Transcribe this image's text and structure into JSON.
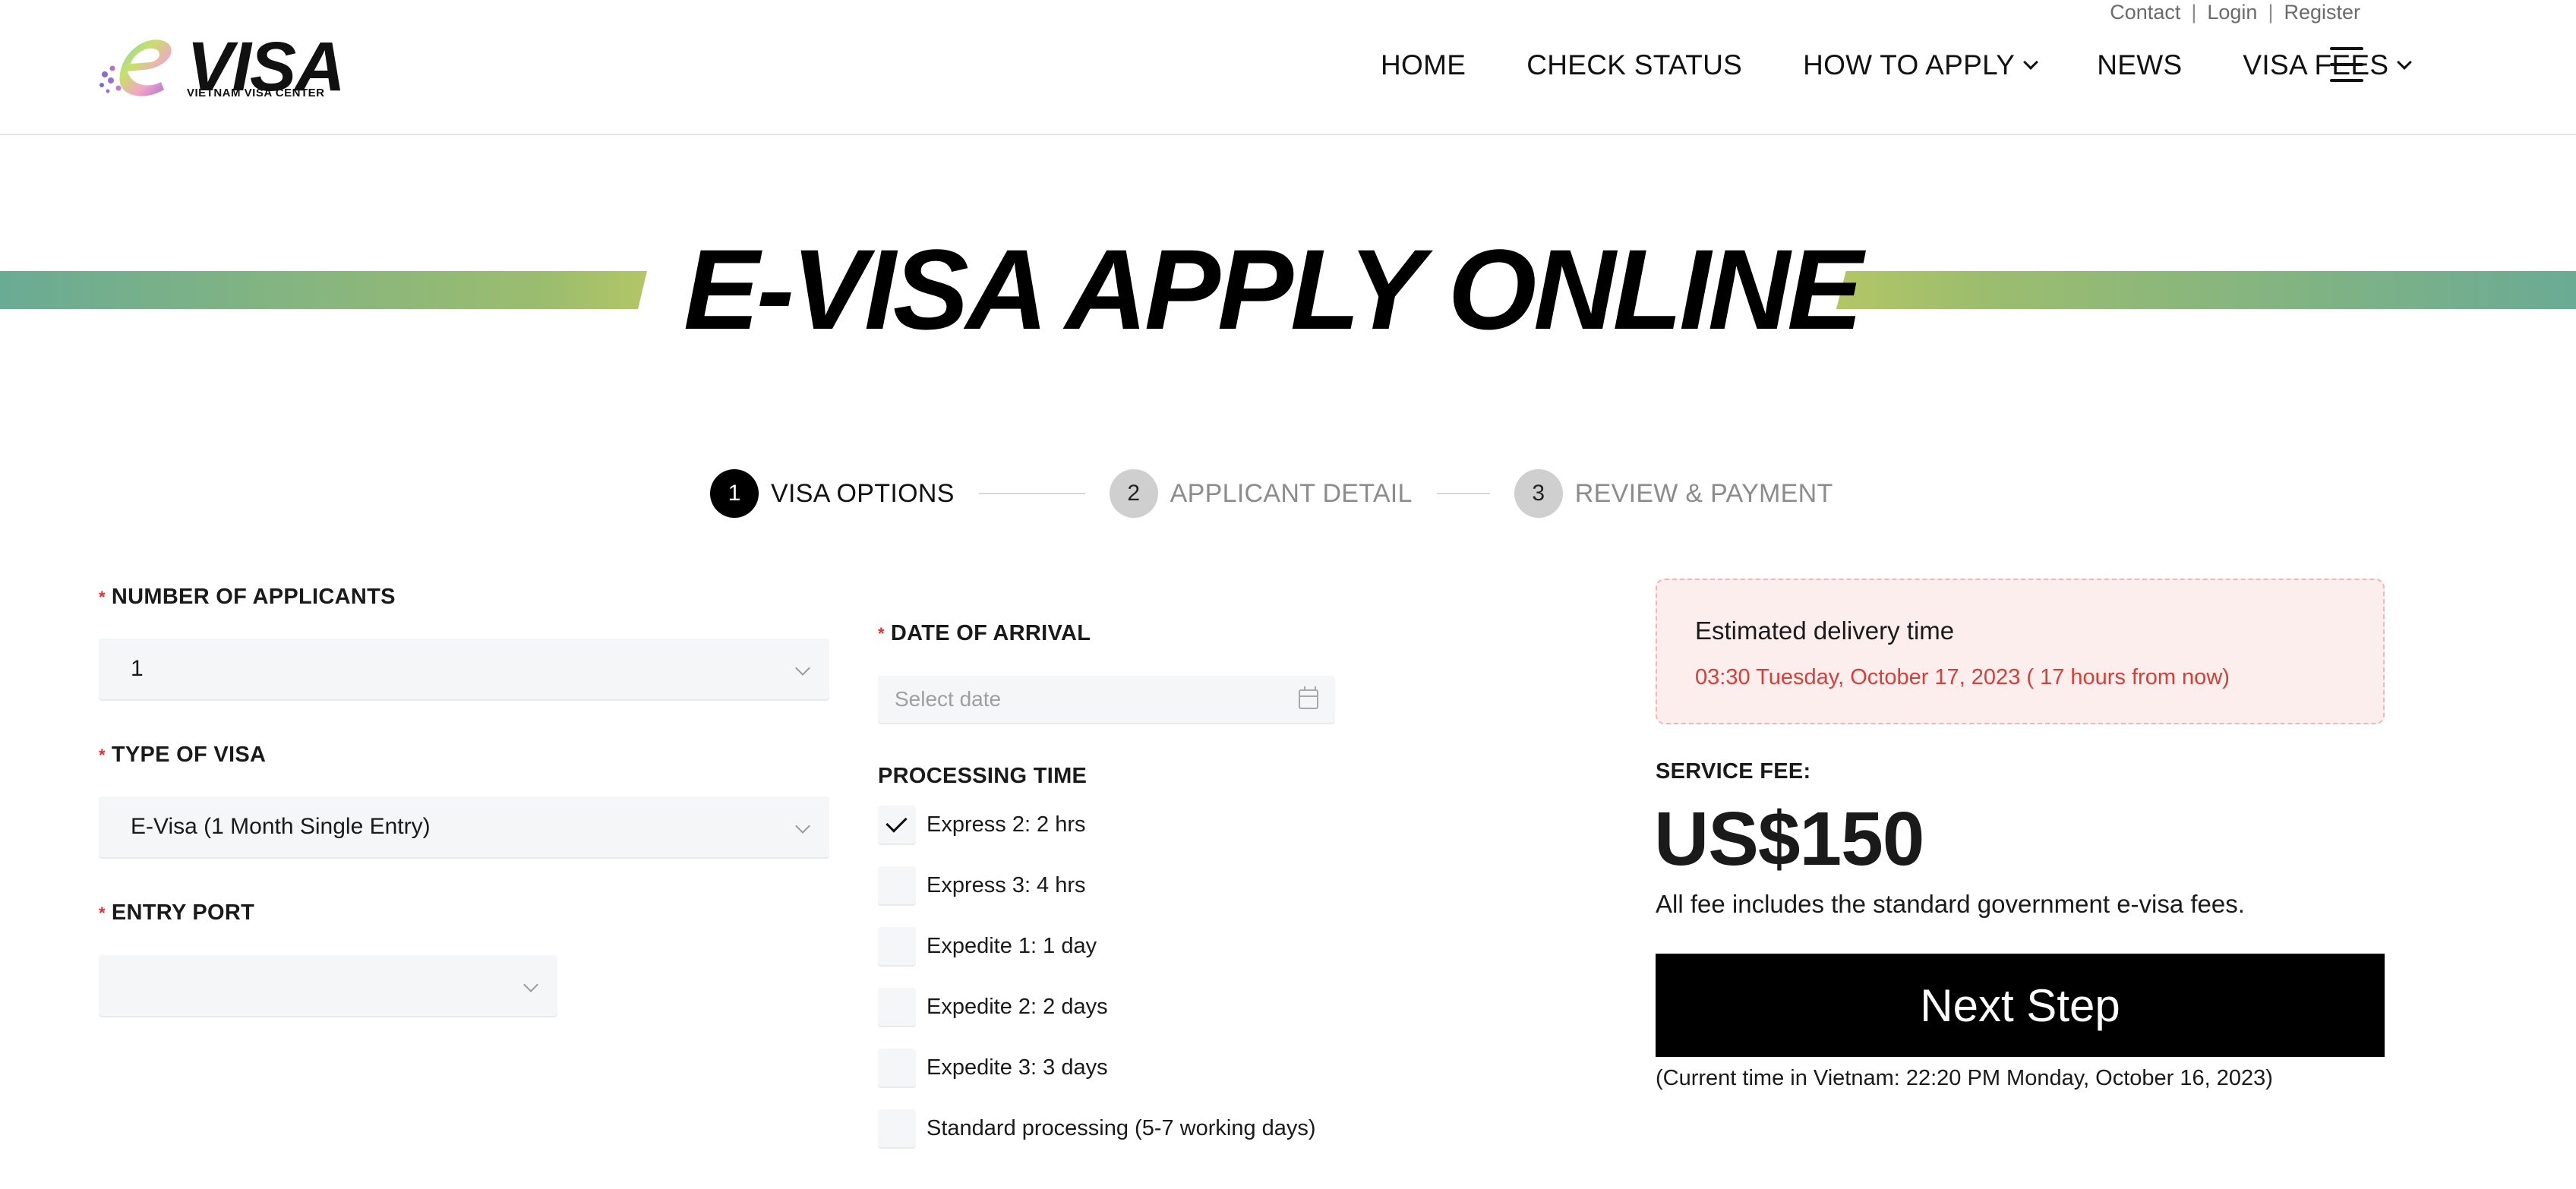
{
  "top_links": {
    "contact": "Contact",
    "login": "Login",
    "register": "Register",
    "separator": "|"
  },
  "logo": {
    "mark": "e",
    "word": "VISA",
    "subtitle": "VIETNAM VISA CENTER"
  },
  "nav": {
    "items": [
      {
        "label": "HOME",
        "has_dropdown": false
      },
      {
        "label": "CHECK STATUS",
        "has_dropdown": false
      },
      {
        "label": "HOW TO APPLY",
        "has_dropdown": true
      },
      {
        "label": "NEWS",
        "has_dropdown": false
      },
      {
        "label": "VISA FEES",
        "has_dropdown": true
      }
    ],
    "menu_icon": "hamburger-menu-icon"
  },
  "hero": {
    "title": "E-VISA APPLY ONLINE",
    "band_colors": [
      "#6aab95",
      "#b3c665"
    ]
  },
  "steps": [
    {
      "number": "1",
      "label": "VISA OPTIONS",
      "active": true
    },
    {
      "number": "2",
      "label": "APPLICANT DETAIL",
      "active": false
    },
    {
      "number": "3",
      "label": "REVIEW & PAYMENT",
      "active": false
    }
  ],
  "form": {
    "required_mark": "*",
    "applicants": {
      "label": "NUMBER OF APPLICANTS",
      "value": "1"
    },
    "visa_type": {
      "label": "TYPE OF VISA",
      "value": "E-Visa (1 Month Single Entry)"
    },
    "entry_port": {
      "label": "ENTRY PORT",
      "value": ""
    },
    "arrival": {
      "label": "DATE OF ARRIVAL",
      "placeholder": "Select date",
      "value": ""
    },
    "processing": {
      "label": "PROCESSING TIME",
      "options": [
        {
          "label": "Express 2: 2 hrs",
          "checked": true
        },
        {
          "label": "Express 3: 4 hrs",
          "checked": false
        },
        {
          "label": "Expedite 1: 1 day",
          "checked": false
        },
        {
          "label": "Expedite 2: 2 days",
          "checked": false
        },
        {
          "label": "Expedite 3: 3 days",
          "checked": false
        },
        {
          "label": "Standard processing (5-7 working days)",
          "checked": false
        }
      ]
    }
  },
  "summary": {
    "estimate_title": "Estimated delivery time",
    "estimate_time": "03:30 Tuesday, October 17, 2023 ( 17 hours from now)",
    "fee_label": "SERVICE FEE:",
    "fee_amount": "US$150",
    "fee_note": "All fee includes the standard government e-visa fees.",
    "next_button": "Next Step",
    "current_time": "(Current time in Vietnam: 22:20 PM Monday, October 16, 2023)"
  },
  "colors": {
    "accent_red": "#d0413a",
    "estimate_bg": "#fdeeee",
    "button_bg": "#000000"
  }
}
